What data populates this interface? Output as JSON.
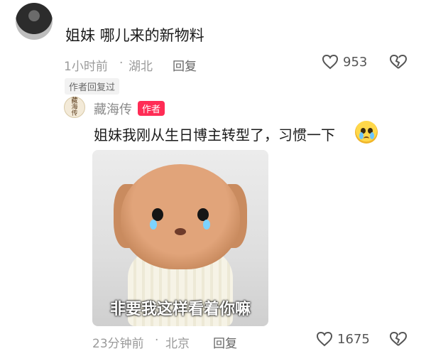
{
  "main_comment": {
    "text": "姐妹 哪儿来的新物料",
    "time": "1小时前",
    "location": "湖北",
    "reply_label": "回复",
    "like_count": "953",
    "author_replied_tag": "作者回复过"
  },
  "author_reply": {
    "avatar_text": "藏海传",
    "name": "藏海传",
    "badge": "作者",
    "text": "姐妹我刚从生日博主转型了，习惯一下",
    "emoji_icon": "crying-face",
    "image_caption": "非要我这样看着你嘛",
    "time": "23分钟前",
    "location": "北京",
    "reply_label": "回复",
    "like_count": "1675"
  },
  "colors": {
    "badge_bg": "#ff2c55",
    "meta_text": "#9a9a9a"
  }
}
